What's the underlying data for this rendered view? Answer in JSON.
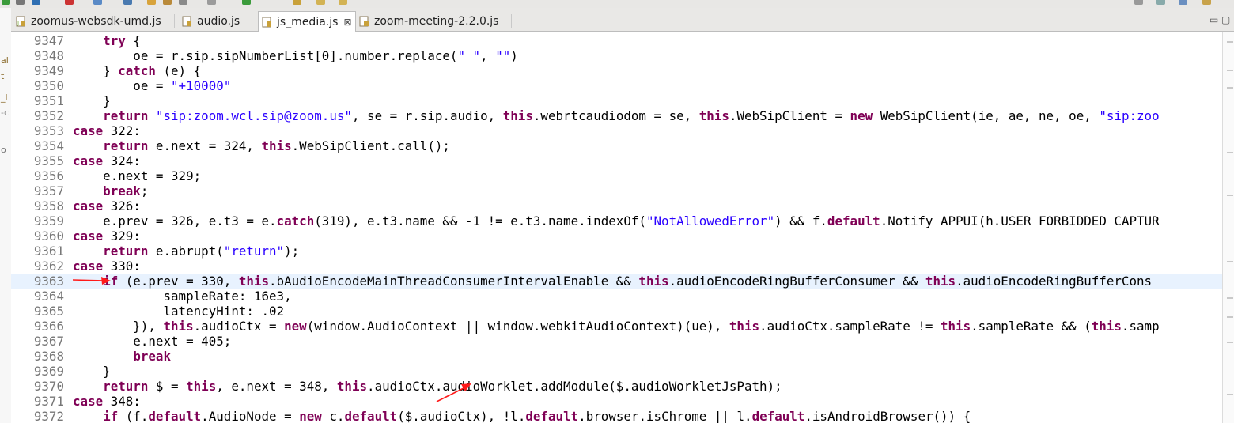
{
  "tabs": [
    {
      "label": "zoomus-websdk-umd.js",
      "active": false
    },
    {
      "label": "audio.js",
      "active": false
    },
    {
      "label": "js_media.js",
      "active": true,
      "close": "⊠"
    },
    {
      "label": "zoom-meeting-2.2.0.js",
      "active": false
    }
  ],
  "left_strip_fragments": [
    "al",
    "t",
    "_l",
    "-c",
    "o"
  ],
  "window_controls": {
    "minimize": "▭",
    "maximize": "▢"
  },
  "colors": {
    "keyword": "#7f0055",
    "string": "#2a00ff",
    "current_line": "#e8f2fe",
    "arrow": "#ff1a1a"
  },
  "current_line_number": "9363",
  "lines": [
    {
      "n": "9347",
      "segs": [
        {
          "t": "    "
        },
        {
          "k": "try"
        },
        {
          "t": " {"
        }
      ]
    },
    {
      "n": "9348",
      "segs": [
        {
          "t": "        oe = r.sip.sipNumberList[0].number.replace("
        },
        {
          "s": "\" \""
        },
        {
          "t": ", "
        },
        {
          "s": "\"\""
        },
        {
          "t": ")"
        }
      ]
    },
    {
      "n": "9349",
      "segs": [
        {
          "t": "    } "
        },
        {
          "k": "catch"
        },
        {
          "t": " (e) {"
        }
      ]
    },
    {
      "n": "9350",
      "segs": [
        {
          "t": "        oe = "
        },
        {
          "s": "\"+10000\""
        }
      ]
    },
    {
      "n": "9351",
      "segs": [
        {
          "t": "    }"
        }
      ]
    },
    {
      "n": "9352",
      "segs": [
        {
          "t": "    "
        },
        {
          "k": "return"
        },
        {
          "t": " "
        },
        {
          "s": "\"sip:zoom.wcl.sip@zoom.us\""
        },
        {
          "t": ", se = r.sip.audio, "
        },
        {
          "k": "this"
        },
        {
          "t": ".webrtcaudiodom = se, "
        },
        {
          "k": "this"
        },
        {
          "t": ".WebSipClient = "
        },
        {
          "k": "new"
        },
        {
          "t": " WebSipClient(ie, ae, ne, oe, "
        },
        {
          "s": "\"sip:zoo"
        }
      ]
    },
    {
      "n": "9353",
      "segs": [
        {
          "k": "case"
        },
        {
          "t": " 322:"
        }
      ]
    },
    {
      "n": "9354",
      "segs": [
        {
          "t": "    "
        },
        {
          "k": "return"
        },
        {
          "t": " e.next = 324, "
        },
        {
          "k": "this"
        },
        {
          "t": ".WebSipClient.call();"
        }
      ]
    },
    {
      "n": "9355",
      "segs": [
        {
          "k": "case"
        },
        {
          "t": " 324:"
        }
      ]
    },
    {
      "n": "9356",
      "segs": [
        {
          "t": "    e.next = 329;"
        }
      ]
    },
    {
      "n": "9357",
      "segs": [
        {
          "t": "    "
        },
        {
          "k": "break"
        },
        {
          "t": ";"
        }
      ]
    },
    {
      "n": "9358",
      "segs": [
        {
          "k": "case"
        },
        {
          "t": " 326:"
        }
      ]
    },
    {
      "n": "9359",
      "segs": [
        {
          "t": "    e.prev = 326, e.t3 = e."
        },
        {
          "k": "catch"
        },
        {
          "t": "(319), e.t3.name && -1 != e.t3.name.indexOf("
        },
        {
          "s": "\"NotAllowedError\""
        },
        {
          "t": ") && f."
        },
        {
          "k": "default"
        },
        {
          "t": ".Notify_APPUI(h.USER_FORBIDDED_CAPTUR"
        }
      ]
    },
    {
      "n": "9360",
      "segs": [
        {
          "k": "case"
        },
        {
          "t": " 329:"
        }
      ]
    },
    {
      "n": "9361",
      "segs": [
        {
          "t": "    "
        },
        {
          "k": "return"
        },
        {
          "t": " e.abrupt("
        },
        {
          "s": "\"return\""
        },
        {
          "t": ");"
        }
      ]
    },
    {
      "n": "9362",
      "segs": [
        {
          "k": "case"
        },
        {
          "t": " 330:"
        }
      ]
    },
    {
      "n": "9363",
      "segs": [
        {
          "t": "    "
        },
        {
          "k": "if"
        },
        {
          "t": " (e.prev = 330, "
        },
        {
          "k": "this"
        },
        {
          "t": ".bAudioEncodeMainThreadConsumerIntervalEnable && "
        },
        {
          "k": "this"
        },
        {
          "t": ".audioEncodeRingBufferConsumer && "
        },
        {
          "k": "this"
        },
        {
          "t": ".audioEncodeRingBufferCons"
        }
      ]
    },
    {
      "n": "9364",
      "segs": [
        {
          "t": "            sampleRate: 16e3,"
        }
      ]
    },
    {
      "n": "9365",
      "segs": [
        {
          "t": "            latencyHint: .02"
        }
      ]
    },
    {
      "n": "9366",
      "segs": [
        {
          "t": "        }), "
        },
        {
          "k": "this"
        },
        {
          "t": ".audioCtx = "
        },
        {
          "k": "new"
        },
        {
          "t": "(window.AudioContext || window.webkitAudioContext)(ue), "
        },
        {
          "k": "this"
        },
        {
          "t": ".audioCtx.sampleRate != "
        },
        {
          "k": "this"
        },
        {
          "t": ".sampleRate && ("
        },
        {
          "k": "this"
        },
        {
          "t": ".samp"
        }
      ]
    },
    {
      "n": "9367",
      "segs": [
        {
          "t": "        e.next = 405;"
        }
      ]
    },
    {
      "n": "9368",
      "segs": [
        {
          "t": "        "
        },
        {
          "k": "break"
        }
      ]
    },
    {
      "n": "9369",
      "segs": [
        {
          "t": "    }"
        }
      ]
    },
    {
      "n": "9370",
      "segs": [
        {
          "t": "    "
        },
        {
          "k": "return"
        },
        {
          "t": " $ = "
        },
        {
          "k": "this"
        },
        {
          "t": ", e.next = 348, "
        },
        {
          "k": "this"
        },
        {
          "t": ".audioCtx.audioWorklet.addModule($.audioWorkletJsPath);"
        }
      ]
    },
    {
      "n": "9371",
      "segs": [
        {
          "k": "case"
        },
        {
          "t": " 348:"
        }
      ]
    },
    {
      "n": "9372",
      "segs": [
        {
          "t": "    "
        },
        {
          "k": "if"
        },
        {
          "t": " (f."
        },
        {
          "k": "default"
        },
        {
          "t": ".AudioNode = "
        },
        {
          "k": "new"
        },
        {
          "t": " c."
        },
        {
          "k": "default"
        },
        {
          "t": "($.audioCtx), !l."
        },
        {
          "k": "default"
        },
        {
          "t": ".browser.isChrome || l."
        },
        {
          "k": "default"
        },
        {
          "t": ".isAndroidBrowser()) {"
        }
      ]
    }
  ]
}
